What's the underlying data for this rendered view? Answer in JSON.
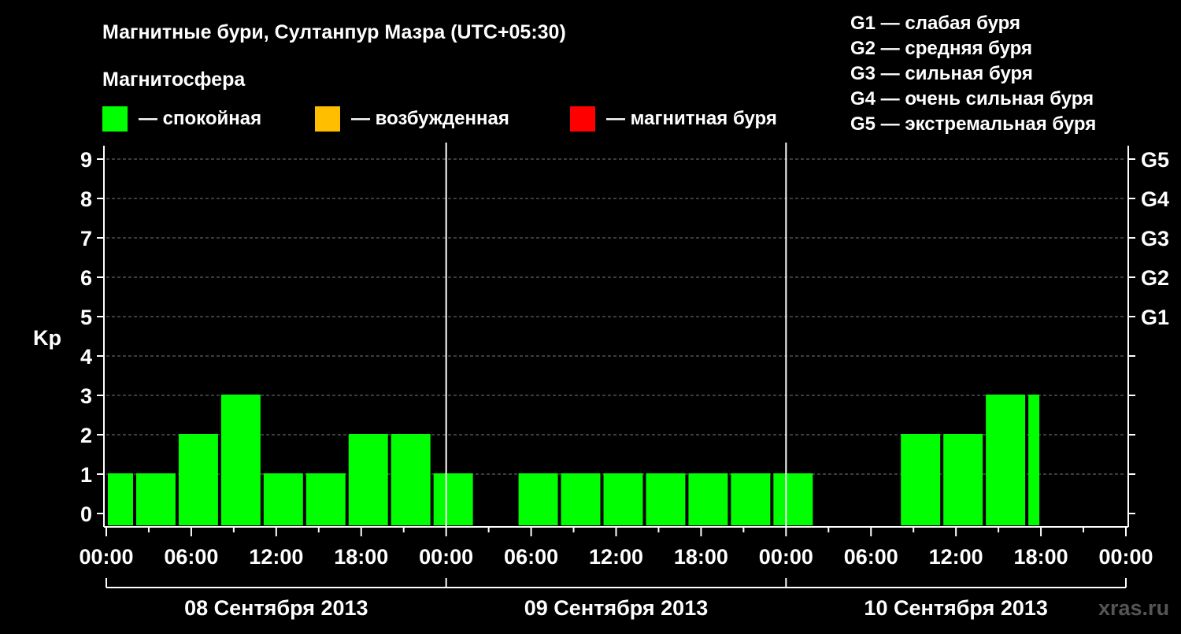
{
  "header": {
    "title": "Магнитные бури, Султанпур Мазра (UTC+05:30)",
    "legend_title": "Магнитосфера",
    "legend": [
      {
        "label": "— спокойная",
        "color": "#00ff00"
      },
      {
        "label": "— возбужденная",
        "color": "#ffbf00"
      },
      {
        "label": "— магнитная буря",
        "color": "#ff0000"
      }
    ],
    "storm_levels": [
      "G1 — слабая буря",
      "G2 — средняя буря",
      "G3 — сильная буря",
      "G4 — очень сильная буря",
      "G5 — экстремальная буря"
    ]
  },
  "watermark": "xras.ru",
  "chart_data": {
    "type": "bar",
    "ylabel": "Kp",
    "ylim": [
      0,
      9
    ],
    "yticks": [
      "0",
      "1",
      "2",
      "3",
      "4",
      "5",
      "6",
      "7",
      "8",
      "9"
    ],
    "right_ticks": [
      {
        "value": 5,
        "label": "G1"
      },
      {
        "value": 6,
        "label": "G2"
      },
      {
        "value": 7,
        "label": "G3"
      },
      {
        "value": 8,
        "label": "G4"
      },
      {
        "value": 9,
        "label": "G5"
      }
    ],
    "xrange_hours": [
      0,
      72
    ],
    "xticks": [
      "00:00",
      "06:00",
      "12:00",
      "18:00",
      "00:00",
      "06:00",
      "12:00",
      "18:00",
      "00:00",
      "06:00",
      "12:00",
      "18:00",
      "00:00"
    ],
    "days": [
      "08 Сентября 2013",
      "09 Сентября 2013",
      "10 Сентября 2013"
    ],
    "grid": "dashed horizontal",
    "bar_color": "#00ff00",
    "bars": [
      {
        "start": 0,
        "end": 2,
        "kp": 1
      },
      {
        "start": 2,
        "end": 5,
        "kp": 1
      },
      {
        "start": 5,
        "end": 8,
        "kp": 2
      },
      {
        "start": 8,
        "end": 11,
        "kp": 3
      },
      {
        "start": 11,
        "end": 14,
        "kp": 1
      },
      {
        "start": 14,
        "end": 17,
        "kp": 1
      },
      {
        "start": 17,
        "end": 20,
        "kp": 2
      },
      {
        "start": 20,
        "end": 23,
        "kp": 2
      },
      {
        "start": 23,
        "end": 26,
        "kp": 1
      },
      {
        "start": 26,
        "end": 29,
        "kp": 0
      },
      {
        "start": 29,
        "end": 32,
        "kp": 1
      },
      {
        "start": 32,
        "end": 35,
        "kp": 1
      },
      {
        "start": 35,
        "end": 38,
        "kp": 1
      },
      {
        "start": 38,
        "end": 41,
        "kp": 1
      },
      {
        "start": 41,
        "end": 44,
        "kp": 1
      },
      {
        "start": 44,
        "end": 47,
        "kp": 1
      },
      {
        "start": 47,
        "end": 50,
        "kp": 1
      },
      {
        "start": 50,
        "end": 53,
        "kp": 0
      },
      {
        "start": 53,
        "end": 56,
        "kp": 0
      },
      {
        "start": 56,
        "end": 59,
        "kp": 2
      },
      {
        "start": 59,
        "end": 62,
        "kp": 2
      },
      {
        "start": 62,
        "end": 65,
        "kp": 3
      },
      {
        "start": 65,
        "end": 66,
        "kp": 3
      }
    ]
  }
}
